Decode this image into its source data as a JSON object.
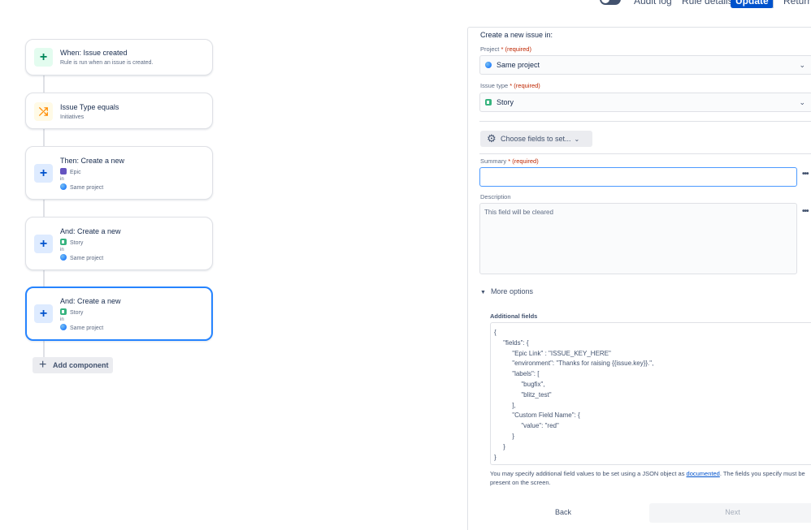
{
  "topbar": {
    "toggle_icon": "x",
    "audit_log": "Audit log",
    "rule_details": "Rule details",
    "update": "Update",
    "return": "Return t"
  },
  "rule": {
    "cards": [
      {
        "title": "When: Issue created",
        "sub": "Rule is run when an issue is created.",
        "icon": "plus-icon",
        "color": "#00875a"
      },
      {
        "title": "Issue Type equals",
        "sub": "Initiatives",
        "icon": "shuffle-icon",
        "color": "#ff8b00"
      },
      {
        "title": "Then: Create a new",
        "type": "Epic",
        "in": "in",
        "project": "Same project",
        "icon": "plus-icon"
      },
      {
        "title": "And: Create a new",
        "type": "Story",
        "in": "in",
        "project": "Same project",
        "icon": "plus-icon"
      },
      {
        "title": "And: Create a new",
        "type": "Story",
        "in": "in",
        "project": "Same project",
        "icon": "plus-icon"
      }
    ],
    "add_component": "Add component"
  },
  "form": {
    "heading": "Create a new issue in:",
    "project_label": "Project",
    "required_mark": "*",
    "required_text": "(required)",
    "project_value": "Same project",
    "issue_type_label": "Issue type",
    "issue_type_value": "Story",
    "choose_fields": "Choose fields to set...",
    "summary_label": "Summary",
    "summary_value": "",
    "description_label": "Description",
    "description_placeholder": "This field will be cleared",
    "more_options": "More options",
    "additional_fields_label": "Additional fields",
    "additional_fields_json": "{\n     \"fields\": {\n          \"Epic Link\" : \"ISSUE_KEY_HERE\"\n          \"environment\": \"Thanks for raising {{issue.key}}.\",\n          \"labels\": [\n               \"bugfix\",\n               \"blitz_test\"\n          ],\n          \"Custom Field Name\": {\n               \"value\": \"red\"\n          }\n     }\n}",
    "help_before": "You may specify additional field values to be set using a JSON object as ",
    "help_link": "documented",
    "help_after": ". The fields you specify must be present on the screen.",
    "back": "Back",
    "next": "Next"
  },
  "colors": {
    "primary": "#0052cc",
    "selected_border": "#2684ff",
    "required": "#bf2600"
  }
}
